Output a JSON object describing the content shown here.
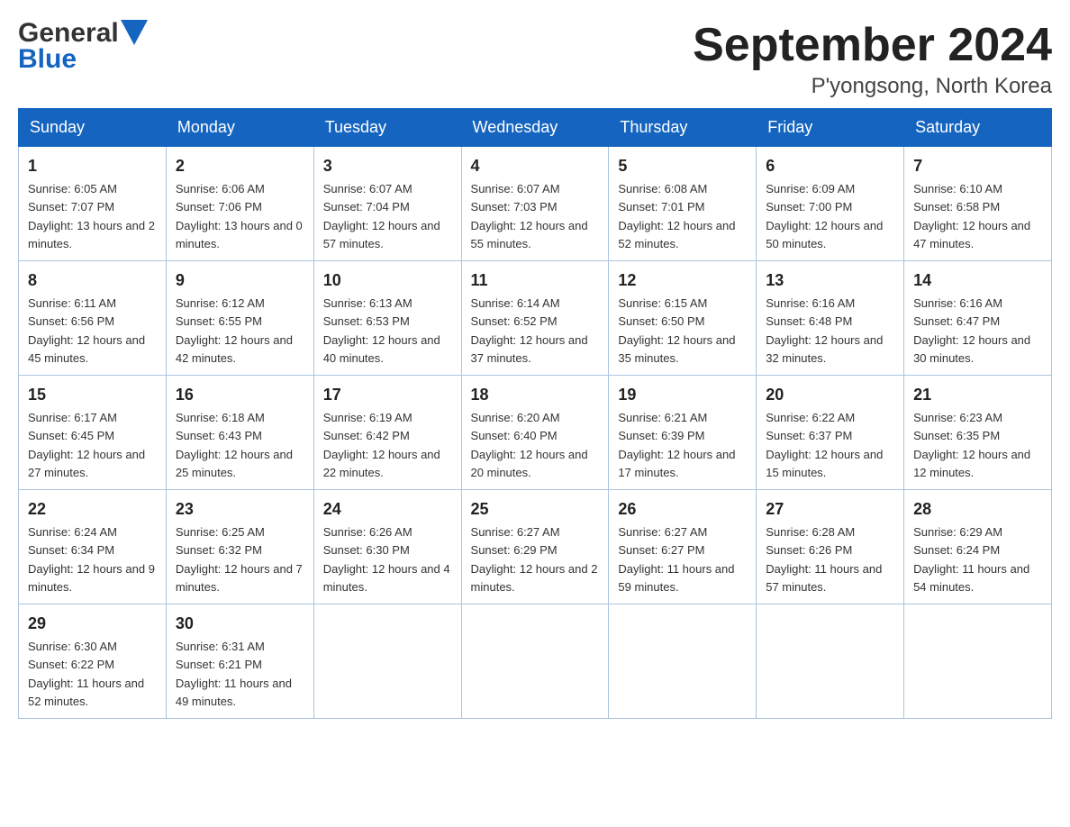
{
  "header": {
    "logo_line1": "General",
    "logo_line2": "Blue",
    "month_title": "September 2024",
    "location": "P'yongsong, North Korea"
  },
  "days_of_week": [
    "Sunday",
    "Monday",
    "Tuesday",
    "Wednesday",
    "Thursday",
    "Friday",
    "Saturday"
  ],
  "weeks": [
    [
      {
        "day": "1",
        "sunrise": "6:05 AM",
        "sunset": "7:07 PM",
        "daylight": "13 hours and 2 minutes."
      },
      {
        "day": "2",
        "sunrise": "6:06 AM",
        "sunset": "7:06 PM",
        "daylight": "13 hours and 0 minutes."
      },
      {
        "day": "3",
        "sunrise": "6:07 AM",
        "sunset": "7:04 PM",
        "daylight": "12 hours and 57 minutes."
      },
      {
        "day": "4",
        "sunrise": "6:07 AM",
        "sunset": "7:03 PM",
        "daylight": "12 hours and 55 minutes."
      },
      {
        "day": "5",
        "sunrise": "6:08 AM",
        "sunset": "7:01 PM",
        "daylight": "12 hours and 52 minutes."
      },
      {
        "day": "6",
        "sunrise": "6:09 AM",
        "sunset": "7:00 PM",
        "daylight": "12 hours and 50 minutes."
      },
      {
        "day": "7",
        "sunrise": "6:10 AM",
        "sunset": "6:58 PM",
        "daylight": "12 hours and 47 minutes."
      }
    ],
    [
      {
        "day": "8",
        "sunrise": "6:11 AM",
        "sunset": "6:56 PM",
        "daylight": "12 hours and 45 minutes."
      },
      {
        "day": "9",
        "sunrise": "6:12 AM",
        "sunset": "6:55 PM",
        "daylight": "12 hours and 42 minutes."
      },
      {
        "day": "10",
        "sunrise": "6:13 AM",
        "sunset": "6:53 PM",
        "daylight": "12 hours and 40 minutes."
      },
      {
        "day": "11",
        "sunrise": "6:14 AM",
        "sunset": "6:52 PM",
        "daylight": "12 hours and 37 minutes."
      },
      {
        "day": "12",
        "sunrise": "6:15 AM",
        "sunset": "6:50 PM",
        "daylight": "12 hours and 35 minutes."
      },
      {
        "day": "13",
        "sunrise": "6:16 AM",
        "sunset": "6:48 PM",
        "daylight": "12 hours and 32 minutes."
      },
      {
        "day": "14",
        "sunrise": "6:16 AM",
        "sunset": "6:47 PM",
        "daylight": "12 hours and 30 minutes."
      }
    ],
    [
      {
        "day": "15",
        "sunrise": "6:17 AM",
        "sunset": "6:45 PM",
        "daylight": "12 hours and 27 minutes."
      },
      {
        "day": "16",
        "sunrise": "6:18 AM",
        "sunset": "6:43 PM",
        "daylight": "12 hours and 25 minutes."
      },
      {
        "day": "17",
        "sunrise": "6:19 AM",
        "sunset": "6:42 PM",
        "daylight": "12 hours and 22 minutes."
      },
      {
        "day": "18",
        "sunrise": "6:20 AM",
        "sunset": "6:40 PM",
        "daylight": "12 hours and 20 minutes."
      },
      {
        "day": "19",
        "sunrise": "6:21 AM",
        "sunset": "6:39 PM",
        "daylight": "12 hours and 17 minutes."
      },
      {
        "day": "20",
        "sunrise": "6:22 AM",
        "sunset": "6:37 PM",
        "daylight": "12 hours and 15 minutes."
      },
      {
        "day": "21",
        "sunrise": "6:23 AM",
        "sunset": "6:35 PM",
        "daylight": "12 hours and 12 minutes."
      }
    ],
    [
      {
        "day": "22",
        "sunrise": "6:24 AM",
        "sunset": "6:34 PM",
        "daylight": "12 hours and 9 minutes."
      },
      {
        "day": "23",
        "sunrise": "6:25 AM",
        "sunset": "6:32 PM",
        "daylight": "12 hours and 7 minutes."
      },
      {
        "day": "24",
        "sunrise": "6:26 AM",
        "sunset": "6:30 PM",
        "daylight": "12 hours and 4 minutes."
      },
      {
        "day": "25",
        "sunrise": "6:27 AM",
        "sunset": "6:29 PM",
        "daylight": "12 hours and 2 minutes."
      },
      {
        "day": "26",
        "sunrise": "6:27 AM",
        "sunset": "6:27 PM",
        "daylight": "11 hours and 59 minutes."
      },
      {
        "day": "27",
        "sunrise": "6:28 AM",
        "sunset": "6:26 PM",
        "daylight": "11 hours and 57 minutes."
      },
      {
        "day": "28",
        "sunrise": "6:29 AM",
        "sunset": "6:24 PM",
        "daylight": "11 hours and 54 minutes."
      }
    ],
    [
      {
        "day": "29",
        "sunrise": "6:30 AM",
        "sunset": "6:22 PM",
        "daylight": "11 hours and 52 minutes."
      },
      {
        "day": "30",
        "sunrise": "6:31 AM",
        "sunset": "6:21 PM",
        "daylight": "11 hours and 49 minutes."
      },
      null,
      null,
      null,
      null,
      null
    ]
  ]
}
